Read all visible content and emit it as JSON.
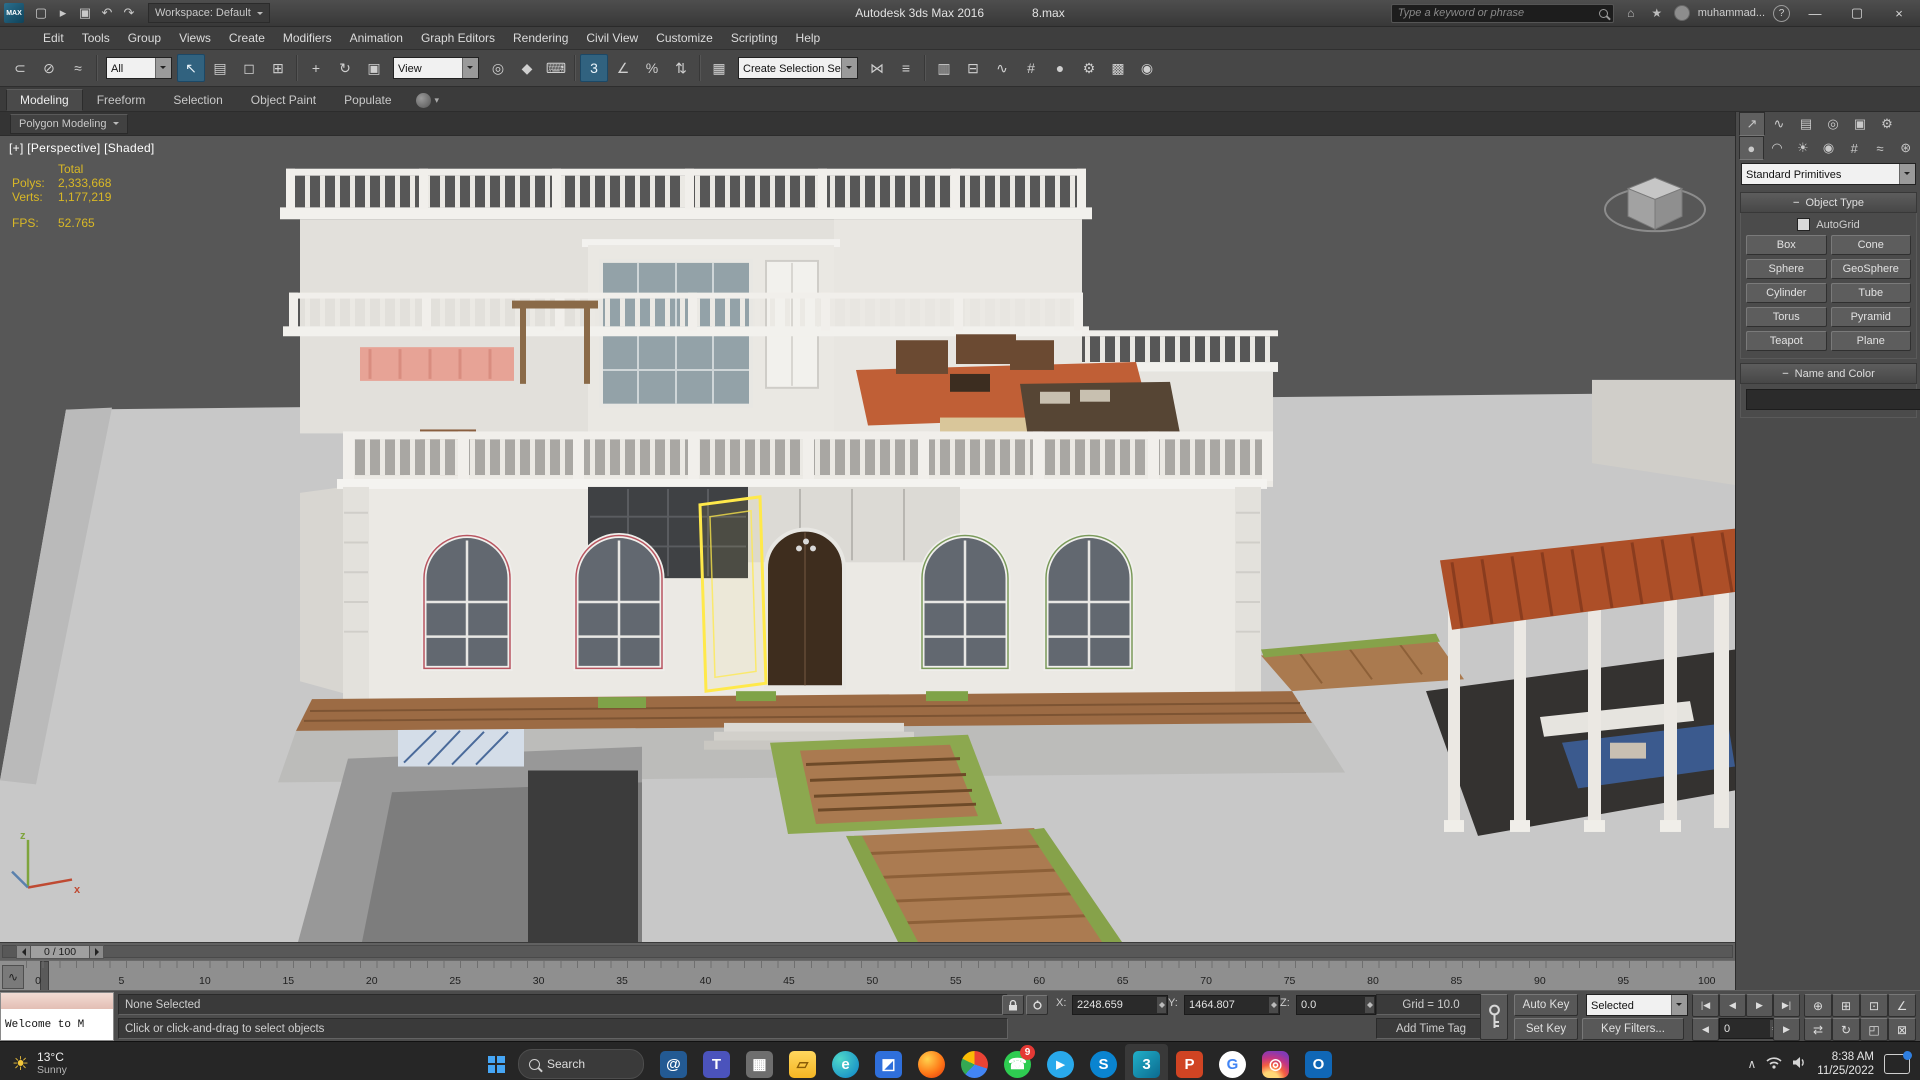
{
  "colors": {
    "selection_highlight": "#ffe94a",
    "name_color_swatch": "#df3d7c",
    "viewport_stats_text": "#d9b826",
    "toolbar_active": "#31627f"
  },
  "titlebar": {
    "logo": "MAX",
    "quick_access": [
      {
        "name": "new-scene",
        "glyph": "▢"
      },
      {
        "name": "open-file",
        "glyph": "▸"
      },
      {
        "name": "save-file",
        "glyph": "▣"
      },
      {
        "name": "undo",
        "glyph": "↶"
      },
      {
        "name": "redo",
        "glyph": "↷"
      }
    ],
    "workspace": "Workspace: Default",
    "app_title": "Autodesk 3ds Max 2016",
    "file_name": "8.max",
    "search_placeholder": "Type a keyword or phrase",
    "username": "muhammad...",
    "icons": {
      "community": "⌂",
      "favorites": "★",
      "help": "?"
    },
    "window": {
      "minimize": "—",
      "restore": "▢",
      "close": "×"
    }
  },
  "menubar": {
    "items": [
      "Edit",
      "Tools",
      "Group",
      "Views",
      "Create",
      "Modifiers",
      "Animation",
      "Graph Editors",
      "Rendering",
      "Civil View",
      "Customize",
      "Scripting",
      "Help"
    ]
  },
  "toolbar": {
    "filter": "All",
    "view": "View",
    "selection_set": "Create Selection Se",
    "icons": [
      {
        "name": "select-and-link",
        "glyph": "⊂"
      },
      {
        "name": "unlink-selection",
        "glyph": "⊘"
      },
      {
        "name": "bind-to-space-warp",
        "glyph": "≈"
      },
      {
        "name": "select-object",
        "glyph": "↖"
      },
      {
        "name": "select-by-name",
        "glyph": "▤"
      },
      {
        "name": "rectangular-selection-region",
        "glyph": "◻"
      },
      {
        "name": "window-crossing-toggle",
        "glyph": "⊞"
      },
      {
        "name": "select-and-move",
        "glyph": "+"
      },
      {
        "name": "select-and-rotate",
        "glyph": "↻"
      },
      {
        "name": "select-and-uniform-scale",
        "glyph": "▣"
      },
      {
        "name": "use-center-flyout",
        "glyph": "◎"
      },
      {
        "name": "select-and-manipulate",
        "glyph": "◆"
      },
      {
        "name": "keyboard-shortcut-override",
        "glyph": "⌨"
      },
      {
        "name": "snaps-toggle",
        "glyph": "3"
      },
      {
        "name": "angle-snap-toggle",
        "glyph": "∠"
      },
      {
        "name": "percent-snap-toggle",
        "glyph": "%"
      },
      {
        "name": "spinner-snap-toggle",
        "glyph": "⇅"
      },
      {
        "name": "edit-named-selection-sets",
        "glyph": "▦"
      },
      {
        "name": "mirror",
        "glyph": "⋈"
      },
      {
        "name": "align",
        "glyph": "≡"
      },
      {
        "name": "manage-layers",
        "glyph": "▥"
      },
      {
        "name": "graphite-ribbon-toggle",
        "glyph": "⊟"
      },
      {
        "name": "curve-editor",
        "glyph": "∿"
      },
      {
        "name": "schematic-view",
        "glyph": "#"
      },
      {
        "name": "material-editor",
        "glyph": "●"
      },
      {
        "name": "render-setup",
        "glyph": "⚙"
      },
      {
        "name": "rendered-frame-window",
        "glyph": "▩"
      },
      {
        "name": "render-production",
        "glyph": "◉"
      }
    ]
  },
  "ribbon": {
    "tabs": [
      "Modeling",
      "Freeform",
      "Selection",
      "Object Paint",
      "Populate"
    ],
    "strip_button": "Polygon Modeling"
  },
  "viewport": {
    "label": "[+] [Perspective] [Shaded]",
    "stats": {
      "total": "Total",
      "polys_label": "Polys:",
      "polys_value": "2,333,668",
      "verts_label": "Verts:",
      "verts_value": "1,177,219",
      "fps_label": "FPS:",
      "fps_value": "52.765"
    },
    "axis_x": "x",
    "axis_z": "z"
  },
  "command_panel": {
    "tabs": [
      {
        "name": "create",
        "glyph": "↗"
      },
      {
        "name": "modify",
        "glyph": "∿"
      },
      {
        "name": "hierarchy",
        "glyph": "▤"
      },
      {
        "name": "motion",
        "glyph": "◎"
      },
      {
        "name": "display",
        "glyph": "▣"
      },
      {
        "name": "utilities",
        "glyph": "⚙"
      }
    ],
    "categories": [
      {
        "name": "geometry",
        "glyph": "●"
      },
      {
        "name": "shapes",
        "glyph": "◠"
      },
      {
        "name": "lights",
        "glyph": "☀"
      },
      {
        "name": "cameras",
        "glyph": "◉"
      },
      {
        "name": "helpers",
        "glyph": "#"
      },
      {
        "name": "space-warps",
        "glyph": "≈"
      },
      {
        "name": "systems",
        "glyph": "⊛"
      }
    ],
    "category_dropdown": "Standard Primitives",
    "object_type": {
      "title": "Object Type",
      "autogrid": "AutoGrid",
      "buttons": [
        "Box",
        "Cone",
        "Sphere",
        "GeoSphere",
        "Cylinder",
        "Tube",
        "Torus",
        "Pyramid",
        "Teapot",
        "Plane"
      ]
    },
    "name_color": {
      "title": "Name and Color",
      "swatch_style": "background:#df3d7c"
    }
  },
  "timeline": {
    "handle": "0 / 100",
    "mini_curve": "∿",
    "ticks": [
      "0",
      "5",
      "10",
      "15",
      "20",
      "25",
      "30",
      "35",
      "40",
      "45",
      "50",
      "55",
      "60",
      "65",
      "70",
      "75",
      "80",
      "85",
      "90",
      "95",
      "100"
    ]
  },
  "status": {
    "selection": "None Selected",
    "prompt": "Click or click-and-drag to select objects",
    "x_label": "X:",
    "x_value": "2248.659",
    "y_label": "Y:",
    "y_value": "1464.807",
    "z_label": "Z:",
    "z_value": "0.0",
    "grid": "Grid = 10.0",
    "add_time_tag": "Add Time Tag",
    "auto_key": "Auto Key",
    "set_key": "Set Key",
    "selected": "Selected",
    "key_filters": "Key Filters...",
    "frame": "0",
    "playback": {
      "go_start": "|◀",
      "prev": "◀",
      "play": "▶",
      "next": "▶",
      "go_end": "▶|"
    },
    "nav": [
      {
        "name": "zoom",
        "glyph": "⊕"
      },
      {
        "name": "zoom-all",
        "glyph": "⊞"
      },
      {
        "name": "zoom-extents",
        "glyph": "⊡"
      },
      {
        "name": "field-of-view",
        "glyph": "∠"
      },
      {
        "name": "pan",
        "glyph": "⇄"
      },
      {
        "name": "orbit",
        "glyph": "↻"
      },
      {
        "name": "zoom-region",
        "glyph": "◰"
      },
      {
        "name": "maximize-viewport",
        "glyph": "⊠"
      }
    ]
  },
  "welcome": {
    "title": "Welcome to M"
  },
  "taskbar": {
    "weather": {
      "icon": "☀",
      "temp": "13°C",
      "desc": "Sunny"
    },
    "search": "Search",
    "apps": [
      {
        "name": "mail",
        "glyph": "@",
        "style": "background:#235a93;color:#fff"
      },
      {
        "name": "teams",
        "glyph": "T",
        "style": "background:#4b53bc;color:#fff"
      },
      {
        "name": "store",
        "glyph": "▦",
        "style": "background:#6e6e6e;color:#fff"
      },
      {
        "name": "file-explorer",
        "glyph": "▱",
        "style": "background:linear-gradient(#ffd75e,#f5b623);color:#8a5c06"
      },
      {
        "name": "edge",
        "glyph": "e",
        "style": "background:radial-gradient(circle at 30% 30%,#4fd8c9,#0c82c8);color:#fff;border-radius:50%"
      },
      {
        "name": "photos",
        "glyph": "◩",
        "style": "background:#2f6fdb;color:#fff"
      },
      {
        "name": "firefox",
        "glyph": "",
        "style": "background:radial-gradient(circle at 35% 30%,#ffd24d,#ff7a18 55%,#e0340f);border-radius:50%"
      },
      {
        "name": "chrome",
        "glyph": "",
        "style": "background:conic-gradient(#ea4335 0 30%,#4285f4 30% 62%,#34a853 62% 82%,#fbbc05 82%);border-radius:50%"
      },
      {
        "name": "whatsapp",
        "glyph": "☎",
        "style": "background:#2ecc51;color:#fff;border-radius:50%",
        "badge": "9"
      },
      {
        "name": "telegram",
        "glyph": "▶",
        "style": "background:#29a9eb;color:#fff;border-radius:50%;font-size:11px"
      },
      {
        "name": "skype",
        "glyph": "S",
        "style": "background:#0a84d0;color:#fff;border-radius:50%"
      },
      {
        "name": "3ds-max",
        "glyph": "3",
        "style": "background:linear-gradient(135deg,#21b0c9,#0b6a8f);color:#fff"
      },
      {
        "name": "powerpoint",
        "glyph": "P",
        "style": "background:#d04423;color:#fff"
      },
      {
        "name": "google",
        "glyph": "G",
        "style": "background:#fff;color:#4285f4;border-radius:50%"
      },
      {
        "name": "instagram",
        "glyph": "◎",
        "style": "background:radial-gradient(circle at 30% 110%,#ffd776 0 25%,#f56040 45%,#c13584 65%,#833ab4 85%);color:#fff;border-radius:7px"
      },
      {
        "name": "outlook",
        "glyph": "O",
        "style": "background:#1067b6;color:#fff"
      }
    ],
    "clock": {
      "time": "8:38 AM",
      "date": "11/25/2022"
    },
    "tray_chevron": "∧"
  }
}
